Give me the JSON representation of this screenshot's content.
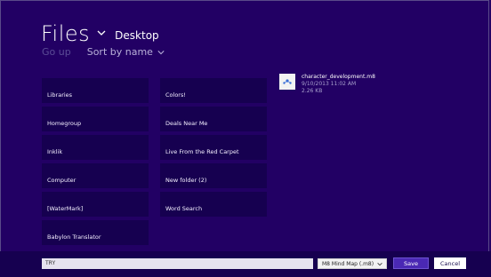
{
  "header": {
    "title": "Files",
    "location": "Desktop"
  },
  "commands": {
    "go_up": "Go up",
    "sort": "Sort by name"
  },
  "tiles_col1": [
    {
      "label": "Libraries"
    },
    {
      "label": "Homegroup"
    },
    {
      "label": "Inklik"
    },
    {
      "label": "Computer"
    },
    {
      "label": "[WaterMark]"
    },
    {
      "label": "Babylon Translator"
    }
  ],
  "tiles_col2": [
    {
      "label": "Colors!"
    },
    {
      "label": "Deals Near Me"
    },
    {
      "label": "Live From the Red Carpet"
    },
    {
      "label": "New folder (2)"
    },
    {
      "label": "Word Search"
    }
  ],
  "file": {
    "name": "character_development.m8",
    "date": "9/10/2013 11:02 AM",
    "size": "2.26 KB",
    "icon": "mind-map-file-icon"
  },
  "bottom": {
    "filename_value": "TRY",
    "file_type": "M8 Mind Map (.m8)",
    "save_label": "Save",
    "cancel_label": "Cancel"
  },
  "colors": {
    "background": "#220064",
    "tile": "#160050",
    "save_button": "#4a28b4"
  }
}
